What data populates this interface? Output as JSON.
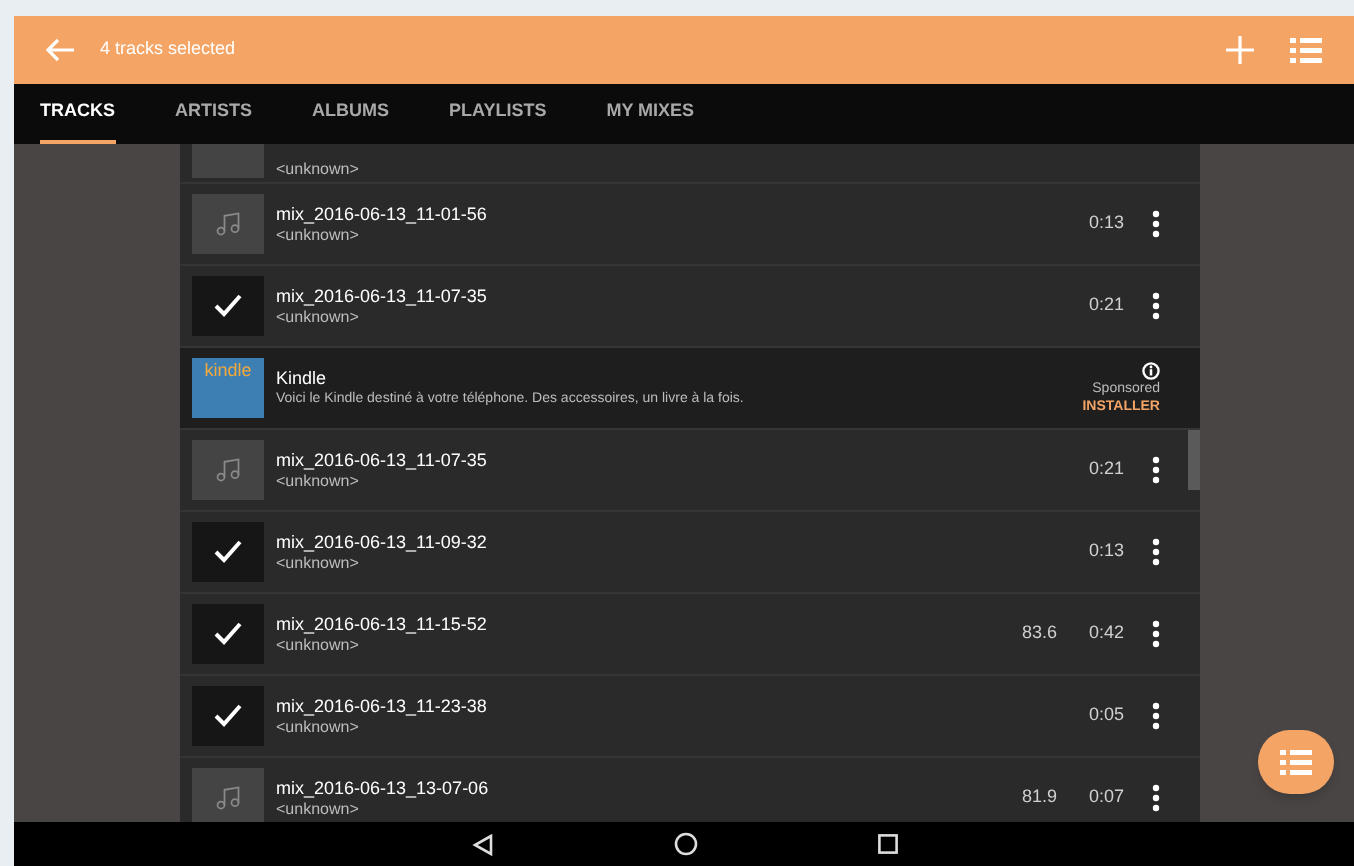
{
  "app_bar": {
    "title": "4 tracks selected"
  },
  "tabs": [
    {
      "label": "TRACKS",
      "selected": true
    },
    {
      "label": "ARTISTS",
      "selected": false
    },
    {
      "label": "ALBUMS",
      "selected": false
    },
    {
      "label": "PLAYLISTS",
      "selected": false
    },
    {
      "label": "MY MIXES",
      "selected": false
    }
  ],
  "rows": [
    {
      "kind": "partial",
      "artist": "<unknown>",
      "selected": false
    },
    {
      "kind": "track",
      "title": "mix_2016-06-13_11-01-56",
      "artist": "<unknown>",
      "duration": "0:13",
      "selected": false
    },
    {
      "kind": "track",
      "title": "mix_2016-06-13_11-07-35",
      "artist": "<unknown>",
      "duration": "0:21",
      "selected": true
    },
    {
      "kind": "ad",
      "title": "Kindle",
      "logo": "kindle",
      "description": "Voici le Kindle destiné à votre téléphone. Des accessoires, un livre à la fois.",
      "sponsored": "Sponsored",
      "action": "INSTALLER"
    },
    {
      "kind": "track",
      "title": "mix_2016-06-13_11-07-35",
      "artist": "<unknown>",
      "duration": "0:21",
      "selected": false
    },
    {
      "kind": "track",
      "title": "mix_2016-06-13_11-09-32",
      "artist": "<unknown>",
      "duration": "0:13",
      "selected": true
    },
    {
      "kind": "track",
      "title": "mix_2016-06-13_11-15-52",
      "artist": "<unknown>",
      "bpm": "83.6",
      "duration": "0:42",
      "selected": true
    },
    {
      "kind": "track",
      "title": "mix_2016-06-13_11-23-38",
      "artist": "<unknown>",
      "duration": "0:05",
      "selected": true
    },
    {
      "kind": "track",
      "title": "mix_2016-06-13_13-07-06",
      "artist": "<unknown>",
      "bpm": "81.9",
      "duration": "0:07",
      "selected": false
    }
  ]
}
